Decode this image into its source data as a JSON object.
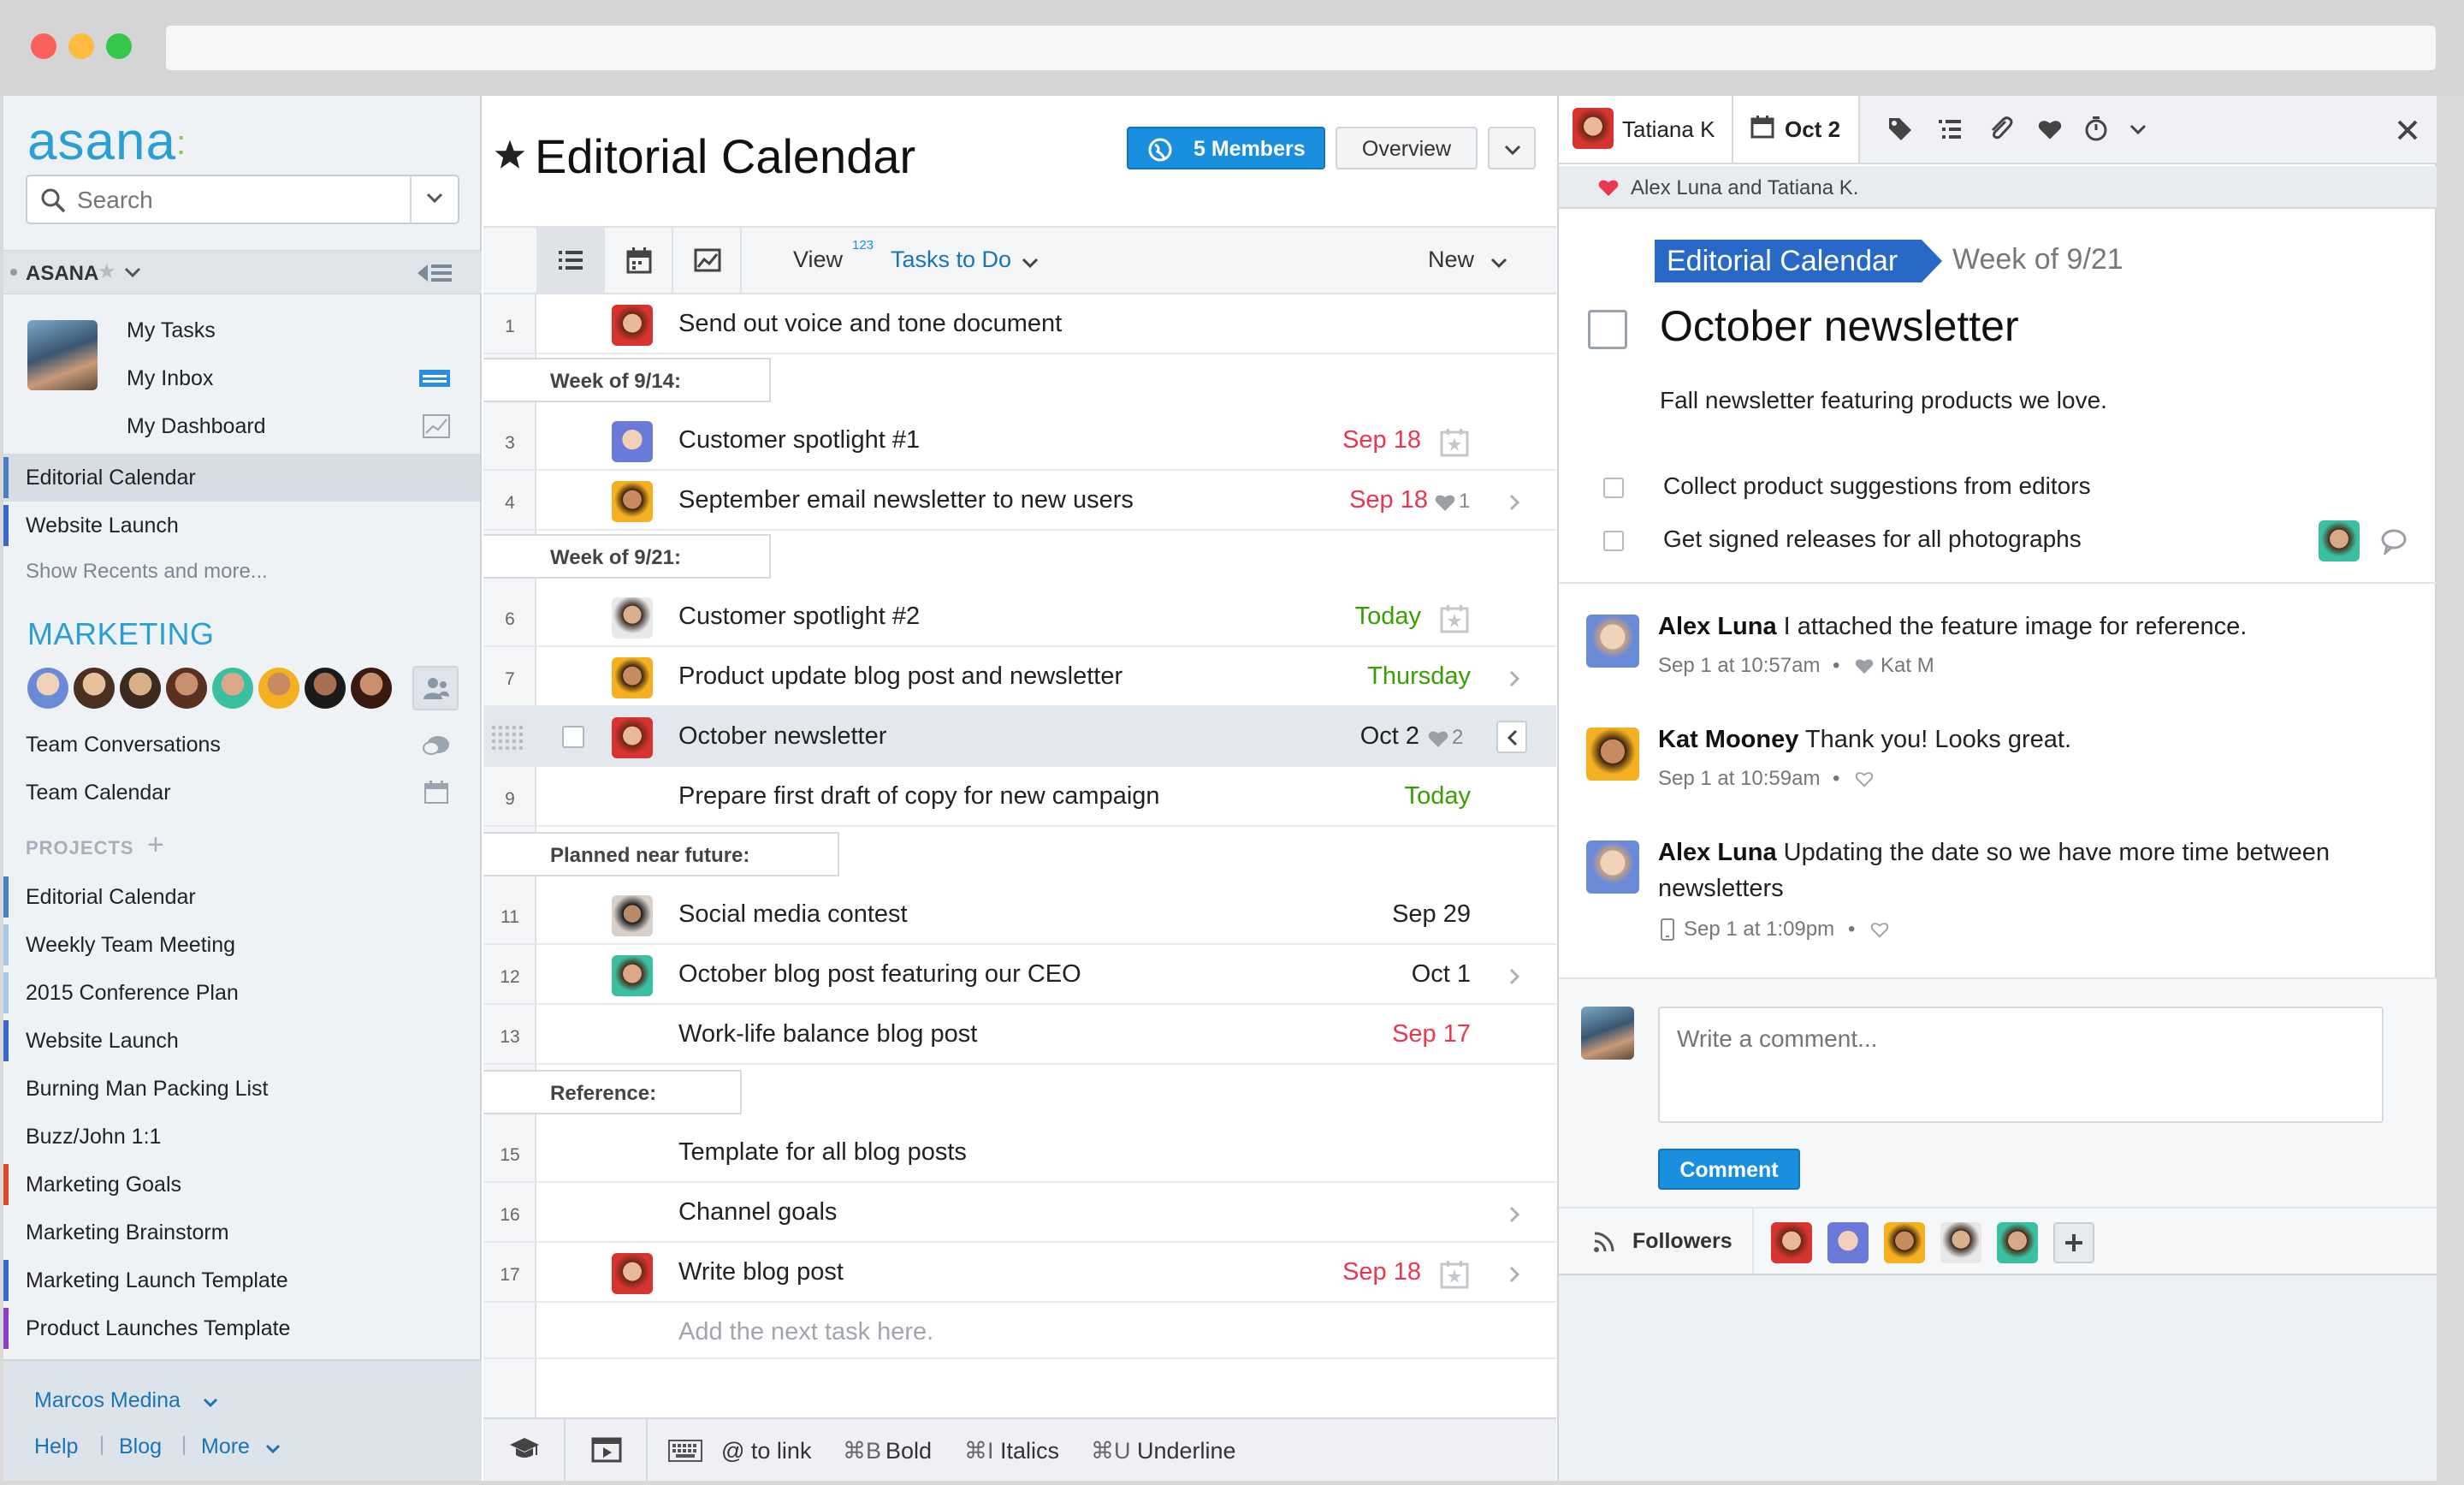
{
  "sidebar": {
    "logo": "asana",
    "search_placeholder": "Search",
    "org_name": "ASANA",
    "personal": {
      "my_tasks": "My Tasks",
      "my_inbox": "My Inbox",
      "my_dashboard": "My Dashboard"
    },
    "recents": [
      {
        "label": "Editorial Calendar",
        "color": "#4a7fc1",
        "selected": true
      },
      {
        "label": "Website Launch",
        "color": "#3b67c9"
      }
    ],
    "show_recents": "Show Recents and more...",
    "team_name": "MARKETING",
    "team_conversations": "Team Conversations",
    "team_calendar": "Team Calendar",
    "projects_header": "PROJECTS",
    "projects": [
      {
        "label": "Editorial Calendar",
        "color": "#4a7fc1"
      },
      {
        "label": "Weekly Team Meeting",
        "color": "#a9c9ea"
      },
      {
        "label": "2015 Conference Plan",
        "color": "#a9c9ea"
      },
      {
        "label": "Website Launch",
        "color": "#3b67c9"
      },
      {
        "label": "Burning Man Packing List",
        "color": ""
      },
      {
        "label": "Buzz/John 1:1",
        "color": ""
      },
      {
        "label": "Marketing Goals",
        "color": "#e0482d"
      },
      {
        "label": "Marketing Brainstorm",
        "color": ""
      },
      {
        "label": "Marketing Launch Template",
        "color": "#3b67c9"
      },
      {
        "label": "Product Launches Template",
        "color": "#8a3fc4"
      }
    ],
    "footer": {
      "user": "Marcos Medina",
      "help": "Help",
      "blog": "Blog",
      "more": "More"
    }
  },
  "project": {
    "title": "Editorial Calendar",
    "members_button": "5 Members",
    "overview_button": "Overview",
    "view_label": "View",
    "view_sup": "123",
    "filter": "Tasks to Do",
    "new_button": "New"
  },
  "tasks": [
    {
      "num": "1",
      "text": "Send out voice and tone document",
      "due": "",
      "avatar": "red"
    },
    {
      "section": "Week of 9/14:"
    },
    {
      "num": "3",
      "text": "Customer spotlight #1",
      "due": "Sep 18",
      "due_color": "#e8384f",
      "avatar": "purple",
      "cal": true
    },
    {
      "num": "4",
      "text": "September email newsletter to new users",
      "due": "Sep 18",
      "due_color": "#e8384f",
      "avatar": "orange",
      "hearts": "1",
      "arrow": true
    },
    {
      "section": "Week of 9/21:"
    },
    {
      "num": "6",
      "text": "Customer spotlight #2",
      "due": "Today",
      "due_color": "#37a000",
      "avatar": "beard",
      "cal": true
    },
    {
      "num": "7",
      "text": "Product update blog post and newsletter",
      "due": "Thursday",
      "due_color": "#37a000",
      "avatar": "orange",
      "arrow": true
    },
    {
      "num": "",
      "text": "October newsletter",
      "due": "Oct 2",
      "due_color": "#222",
      "avatar": "red",
      "hearts": "2",
      "selected": true
    },
    {
      "num": "9",
      "text": "Prepare first draft of copy for new campaign",
      "due": "Today",
      "due_color": "#37a000",
      "avatar": ""
    },
    {
      "section": "Planned near future:"
    },
    {
      "num": "11",
      "text": "Social media contest",
      "due": "Sep 29",
      "due_color": "#222",
      "avatar": "dark"
    },
    {
      "num": "12",
      "text": "October blog post featuring our CEO",
      "due": "Oct 1",
      "due_color": "#222",
      "avatar": "teal",
      "arrow": true
    },
    {
      "num": "13",
      "text": "Work-life balance blog post",
      "due": "Sep 17",
      "due_color": "#e8384f",
      "avatar": ""
    },
    {
      "section": "Reference:"
    },
    {
      "num": "15",
      "text": "Template for all blog posts",
      "due": "",
      "avatar": ""
    },
    {
      "num": "16",
      "text": "Channel goals",
      "due": "",
      "avatar": "",
      "arrow": true
    },
    {
      "num": "17",
      "text": "Write blog post",
      "due": "Sep 18",
      "due_color": "#e8384f",
      "avatar": "red",
      "cal": true,
      "arrow": true
    }
  ],
  "add_task_placeholder": "Add the next task here.",
  "bottom_bar": {
    "link": "@ to link",
    "bold_key": "⌘B",
    "bold": "Bold",
    "italics_key": "⌘I",
    "italics": "Italics",
    "underline_key": "⌘U",
    "underline": "Underline"
  },
  "detail": {
    "assignee": "Tatiana K",
    "due": "Oct 2",
    "hearted_by": "Alex Luna and Tatiana K.",
    "project_tag": "Editorial Calendar",
    "section_tag": "Week of 9/21",
    "title": "October newsletter",
    "description": "Fall newsletter featuring products we love.",
    "subtasks": [
      "Collect product suggestions from editors",
      "Get signed releases for all photographs"
    ],
    "comments": [
      {
        "author": "Alex Luna",
        "text": "I attached the feature image for reference.",
        "meta": "Sep 1 at 10:57am",
        "heart": "Kat M"
      },
      {
        "author": "Kat Mooney",
        "text": "Thank you! Looks great.",
        "meta": "Sep 1 at 10:59am",
        "heart": ""
      },
      {
        "author": "Alex Luna",
        "text": "Updating the date so we have more time between",
        "text2": "newsletters",
        "meta": "Sep 1 at 1:09pm",
        "heart": ""
      }
    ],
    "comment_placeholder": "Write a comment...",
    "comment_button": "Comment",
    "followers_label": "Followers"
  },
  "colors": {
    "accent": "#1a8fde",
    "overdue": "#e8384f",
    "today": "#37a000",
    "brand": "#2a9fd6"
  }
}
